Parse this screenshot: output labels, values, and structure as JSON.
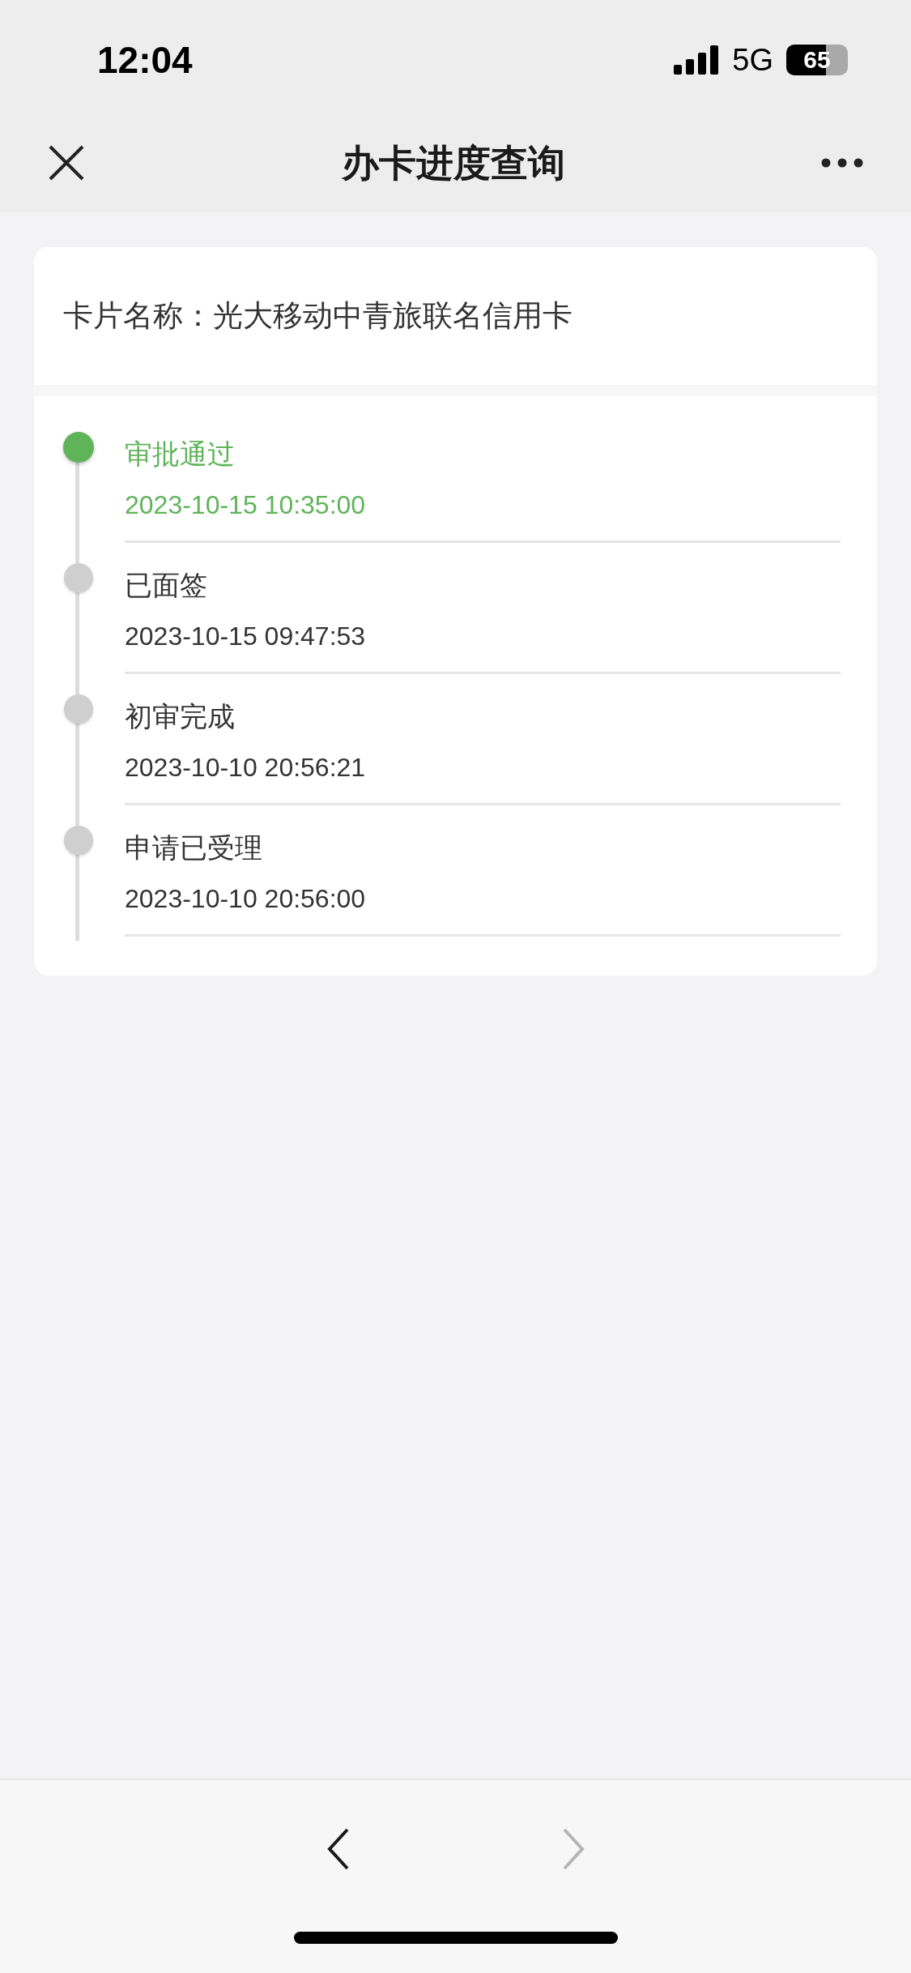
{
  "status_bar": {
    "time": "12:04",
    "network": "5G",
    "battery": "65"
  },
  "nav": {
    "title": "办卡进度查询"
  },
  "card_name": "卡片名称：光大移动中青旅联名信用卡",
  "steps": [
    {
      "title": "审批通过",
      "time": "2023-10-15 10:35:00",
      "current": true
    },
    {
      "title": "已面签",
      "time": "2023-10-15 09:47:53",
      "current": false
    },
    {
      "title": "初审完成",
      "time": "2023-10-10 20:56:21",
      "current": false
    },
    {
      "title": "申请已受理",
      "time": "2023-10-10 20:56:00",
      "current": false
    }
  ],
  "toolbar": {
    "back_disabled": false,
    "forward_disabled": true
  }
}
